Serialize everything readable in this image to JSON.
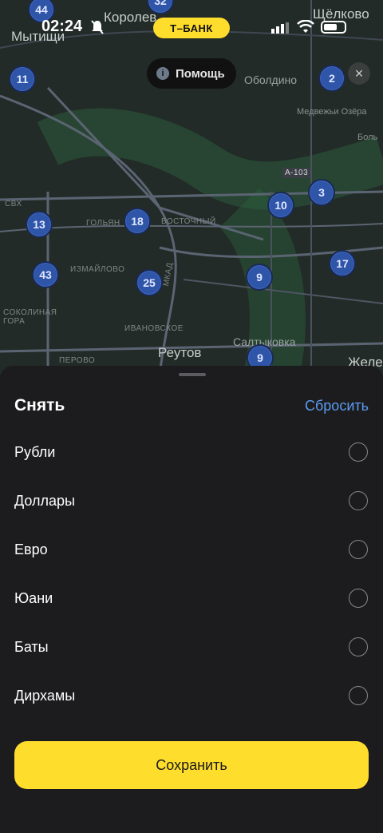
{
  "status_bar": {
    "time": "02:24",
    "bank_badge": "Т–БАНК"
  },
  "map": {
    "help_label": "Помощь",
    "labels": [
      {
        "text": "Королев",
        "cls": "big"
      },
      {
        "text": "Мытищи",
        "cls": "big"
      },
      {
        "text": "Щёлково",
        "cls": "big"
      },
      {
        "text": "Оболдино",
        "cls": ""
      },
      {
        "text": "Медвежьи Озёра",
        "cls": "small"
      },
      {
        "text": "Боль",
        "cls": "small"
      },
      {
        "text": "ВОСТОЧНЫЙ",
        "cls": "tiny"
      },
      {
        "text": "ГОЛЬЯН",
        "cls": "tiny"
      },
      {
        "text": "ИЗМАЙЛОВО",
        "cls": "tiny"
      },
      {
        "text": "ИВАНОВСКОЕ",
        "cls": "tiny"
      },
      {
        "text": "СОКОЛИНАЯ ГОРА",
        "cls": "tiny"
      },
      {
        "text": "ПЕРОВО",
        "cls": "tiny"
      },
      {
        "text": "Реутов",
        "cls": "big"
      },
      {
        "text": "Салтыковка",
        "cls": ""
      },
      {
        "text": "Желе",
        "cls": "big"
      },
      {
        "text": "МКАД",
        "cls": "tiny"
      },
      {
        "text": "СВХ",
        "cls": "tiny"
      },
      {
        "text": "А-103",
        "cls": "tiny"
      }
    ],
    "clusters": [
      "44",
      "32",
      "11",
      "2",
      "3",
      "10",
      "13",
      "18",
      "43",
      "25",
      "17",
      "9",
      "9"
    ]
  },
  "sheet": {
    "title": "Снять",
    "reset_label": "Сбросить",
    "options": [
      "Рубли",
      "Доллары",
      "Евро",
      "Юани",
      "Баты",
      "Дирхамы"
    ],
    "save_label": "Сохранить"
  },
  "colors": {
    "accent": "#ffdd2d",
    "link": "#5b9bf0",
    "sheet_bg": "#1c1c1e",
    "cluster": "#2f55a8"
  }
}
